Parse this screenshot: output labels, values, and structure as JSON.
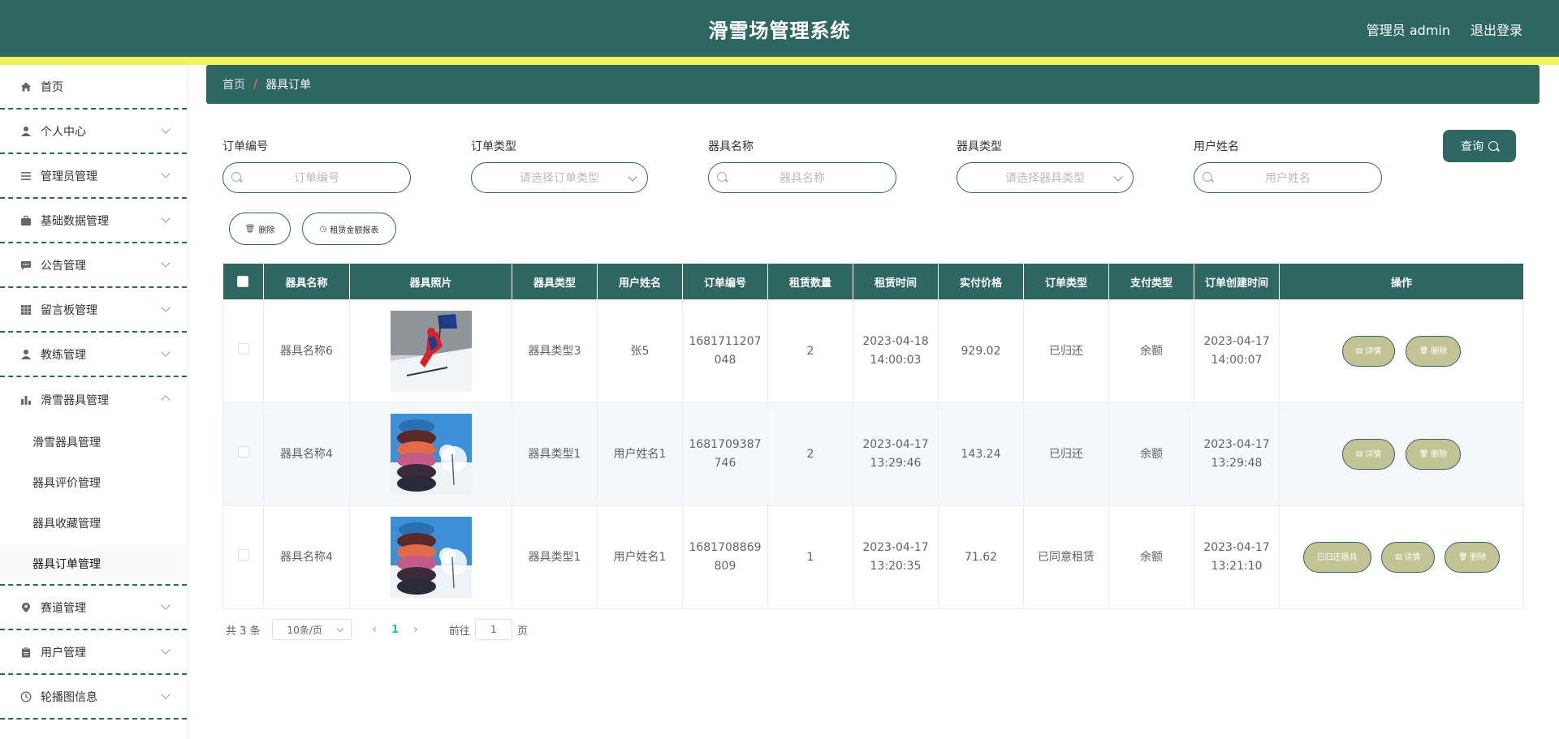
{
  "header": {
    "title": "滑雪场管理系统",
    "user_label": "管理员 admin",
    "logout_label": "退出登录"
  },
  "sidebar": {
    "items": [
      {
        "label": "首页",
        "icon": "home-icon",
        "has_children": false
      },
      {
        "label": "个人中心",
        "icon": "user-icon",
        "has_children": true
      },
      {
        "label": "管理员管理",
        "icon": "list-icon",
        "has_children": true
      },
      {
        "label": "基础数据管理",
        "icon": "briefcase-icon",
        "has_children": true
      },
      {
        "label": "公告管理",
        "icon": "chat-icon",
        "has_children": true
      },
      {
        "label": "留言板管理",
        "icon": "grid-icon",
        "has_children": true
      },
      {
        "label": "教练管理",
        "icon": "user-icon",
        "has_children": true
      },
      {
        "label": "滑雪器具管理",
        "icon": "bar-chart-icon",
        "has_children": true,
        "expanded": true,
        "children": [
          "滑雪器具管理",
          "器具评价管理",
          "器具收藏管理",
          "器具订单管理"
        ],
        "active_child": 3
      },
      {
        "label": "赛道管理",
        "icon": "pin-icon",
        "has_children": true
      },
      {
        "label": "用户管理",
        "icon": "clipboard-icon",
        "has_children": true
      },
      {
        "label": "轮播图信息",
        "icon": "clock-icon",
        "has_children": true
      }
    ]
  },
  "breadcrumb": {
    "home": "首页",
    "separator": "/",
    "current": "器具订单"
  },
  "filters": {
    "order_no": {
      "label": "订单编号",
      "placeholder": "订单编号"
    },
    "order_type": {
      "label": "订单类型",
      "placeholder": "请选择订单类型"
    },
    "equip_name": {
      "label": "器具名称",
      "placeholder": "器具名称"
    },
    "equip_type": {
      "label": "器具类型",
      "placeholder": "请选择器具类型"
    },
    "user_name": {
      "label": "用户姓名",
      "placeholder": "用户姓名"
    },
    "query_label": "查询"
  },
  "actions": {
    "delete_label": "删除",
    "report_label": "租赁金额报表"
  },
  "table": {
    "columns": [
      "器具名称",
      "器具照片",
      "器具类型",
      "用户姓名",
      "订单编号",
      "租赁数量",
      "租赁时间",
      "实付价格",
      "订单类型",
      "支付类型",
      "订单创建时间",
      "操作"
    ],
    "rows": [
      {
        "name": "器具名称6",
        "photo": "skier-photo",
        "type": "器具类型3",
        "user": "张5",
        "order_no_1": "1681711207",
        "order_no_2": "048",
        "qty": "2",
        "rent_date": "2023-04-18",
        "rent_time": "14:00:03",
        "price": "929.02",
        "order_type": "已归还",
        "pay_type": "余额",
        "created_date": "2023-04-17",
        "created_time": "14:00:07",
        "ops": [
          "详情",
          "删除"
        ]
      },
      {
        "name": "器具名称4",
        "photo": "snow-tube-photo",
        "type": "器具类型1",
        "user": "用户姓名1",
        "order_no_1": "1681709387",
        "order_no_2": "746",
        "qty": "2",
        "rent_date": "2023-04-17",
        "rent_time": "13:29:46",
        "price": "143.24",
        "order_type": "已归还",
        "pay_type": "余额",
        "created_date": "2023-04-17",
        "created_time": "13:29:48",
        "ops": [
          "详情",
          "删除"
        ]
      },
      {
        "name": "器具名称4",
        "photo": "snow-tube-photo",
        "type": "器具类型1",
        "user": "用户姓名1",
        "order_no_1": "1681708869",
        "order_no_2": "809",
        "qty": "1",
        "rent_date": "2023-04-17",
        "rent_time": "13:20:35",
        "price": "71.62",
        "order_type": "已同意租赁",
        "pay_type": "余额",
        "created_date": "2023-04-17",
        "created_time": "13:21:10",
        "ops": [
          "已归还器具",
          "详情",
          "删除"
        ]
      }
    ]
  },
  "pagination": {
    "total_label": "共 3 条",
    "page_size": "10条/页",
    "current_page": "1",
    "goto_label": "前往",
    "goto_value": "1",
    "page_suffix": "页"
  },
  "colors": {
    "primary": "#2e6661",
    "stripe": "#f4f25c",
    "op_button": "#c3c396",
    "active_page": "#1fbf8f"
  }
}
